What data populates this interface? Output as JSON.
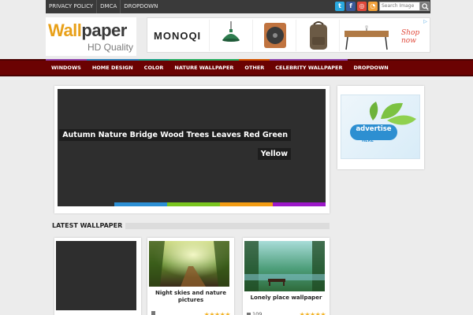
{
  "top_nav": {
    "links": [
      "PRIVACY POLICY",
      "DMCA",
      "DROPDOWN"
    ],
    "social": [
      {
        "icon": "twitter-icon",
        "glyph": "t",
        "color": "#2aa9e0"
      },
      {
        "icon": "facebook-icon",
        "glyph": "f",
        "color": "#3b5998"
      },
      {
        "icon": "instagram-icon",
        "glyph": "◎",
        "color": "#e0483a"
      },
      {
        "icon": "rss-icon",
        "glyph": "◔",
        "color": "#f2a13a"
      }
    ],
    "search_placeholder": "Search Image"
  },
  "logo": {
    "word_part1": "Wall",
    "word_part2": "paper",
    "subtitle": "HD Quality"
  },
  "ad_banner": {
    "brand": "MONOQI",
    "cta": "Shop now"
  },
  "main_nav": {
    "items": [
      {
        "label": "WINDOWS",
        "color": "#8e44ad"
      },
      {
        "label": "HOME DESIGN",
        "color": "#2980b9"
      },
      {
        "label": "COLOR",
        "color": "#16a085"
      },
      {
        "label": "NATURE WALLPAPER",
        "color": "#27ae60"
      },
      {
        "label": "OTHER",
        "color": "#d35400"
      },
      {
        "label": "CELEBRITY WALLPAPER",
        "color": "#8e44ad"
      },
      {
        "label": "DROPDOWN",
        "color": "#6b0202"
      }
    ]
  },
  "slider": {
    "caption_line1": "Autumn Nature Bridge Wood Trees Leaves Red Green",
    "caption_line2": "Yellow",
    "stripe_colors": [
      "#2c8fd4",
      "#7ac51f",
      "#f39c12",
      "#9b18c8"
    ]
  },
  "sidebar_ad": {
    "line1": "advertise",
    "line2": "HERE"
  },
  "latest": {
    "title": "LATEST WALLPAPER",
    "cards": [
      {
        "title": "",
        "views": "",
        "rating": 0
      },
      {
        "title": "Night skies and nature pictures",
        "views": "",
        "rating": 5
      },
      {
        "title": "Lonely place wallpaper",
        "views": "109",
        "rating": 5
      }
    ]
  }
}
